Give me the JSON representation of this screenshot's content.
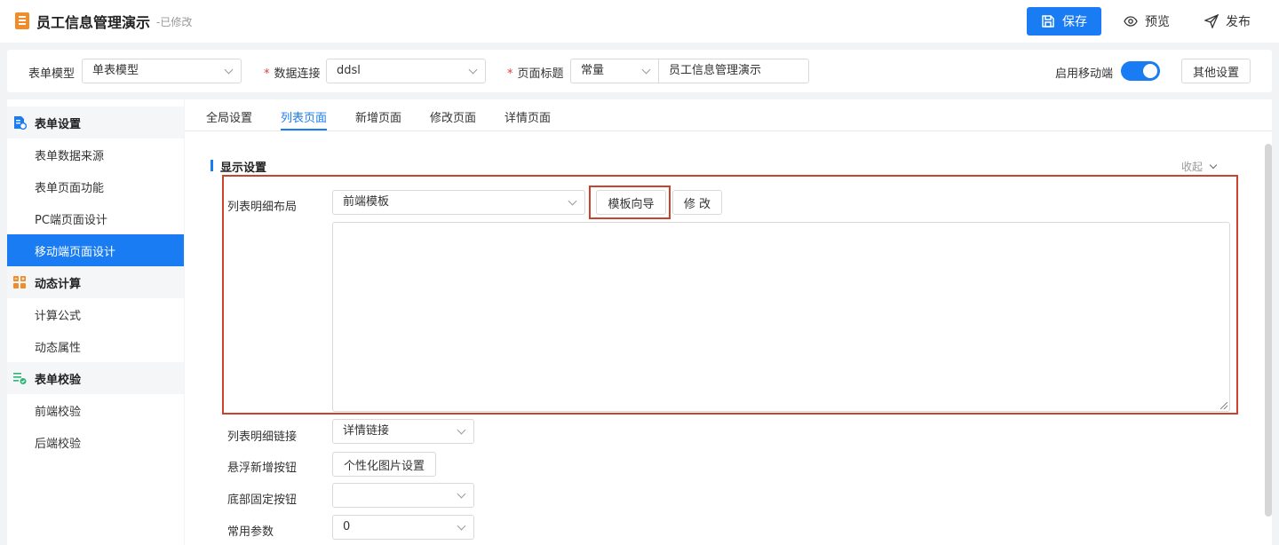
{
  "header": {
    "title": "员工信息管理演示",
    "status": "-已修改",
    "save_label": "保存",
    "preview_label": "预览",
    "publish_label": "发布",
    "icons": [
      "document-icon",
      "save-icon",
      "eye-icon",
      "send-icon"
    ]
  },
  "toolbar": {
    "form_model_label": "表单模型",
    "form_model_value": "单表模型",
    "data_conn_label": "数据连接",
    "data_conn_value": "ddsl",
    "page_title_label": "页面标题",
    "page_title_type": "常量",
    "page_title_value": "员工信息管理演示",
    "mobile_label": "启用移动端",
    "mobile_enabled": true,
    "other_settings_label": "其他设置"
  },
  "sidebar": {
    "groups": [
      {
        "label": "表单设置",
        "icon": "form-settings-icon",
        "color": "#1a7cf2",
        "items": [
          "表单数据来源",
          "表单页面功能",
          "PC端页面设计",
          "移动端页面设计"
        ]
      },
      {
        "label": "动态计算",
        "icon": "calculator-icon",
        "color": "#f08c2a",
        "items": [
          "计算公式",
          "动态属性"
        ]
      },
      {
        "label": "表单校验",
        "icon": "validation-icon",
        "color": "#2bb673",
        "items": [
          "前端校验",
          "后端校验"
        ]
      }
    ],
    "active_item": "移动端页面设计"
  },
  "tabs": [
    "全局设置",
    "列表页面",
    "新增页面",
    "修改页面",
    "详情页面"
  ],
  "active_tab": "列表页面",
  "section": {
    "title": "显示设置",
    "collapse_label": "收起"
  },
  "form": {
    "layout_label": "列表明细布局",
    "layout_value": "前端模板",
    "template_wizard_label": "模板向导",
    "edit_label": "修 改",
    "template_content": "",
    "link_label": "列表明细链接",
    "link_value": "详情链接",
    "float_button_label": "悬浮新增按钮",
    "float_button_action": "个性化图片设置",
    "bottom_button_label": "底部固定按钮",
    "bottom_button_value": "",
    "common_params_label": "常用参数",
    "common_params_value": "0"
  },
  "colors": {
    "accent": "#1a7cf2",
    "highlight": "#c9432f",
    "required": "#e23b3b"
  }
}
